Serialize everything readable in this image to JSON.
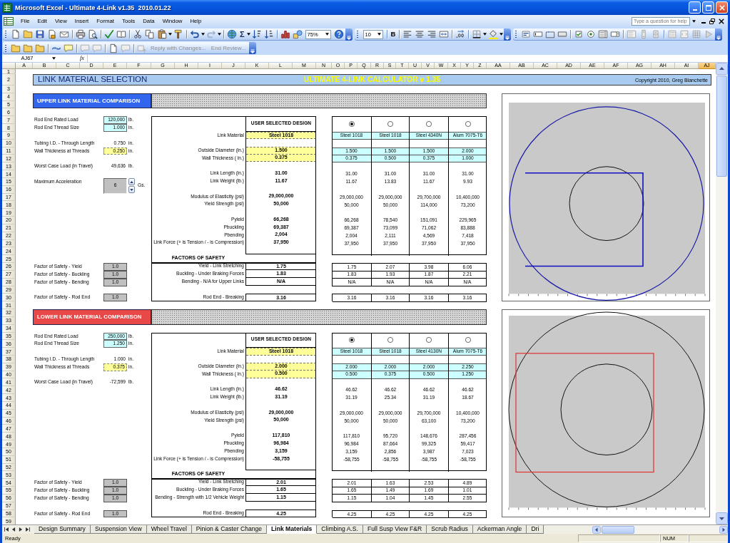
{
  "window": {
    "title": "Microsoft Excel - Ultimate 4-Link v1.35  2010.01.22"
  },
  "menu": [
    "File",
    "Edit",
    "View",
    "Insert",
    "Format",
    "Tools",
    "Data",
    "Window",
    "Help"
  ],
  "help_search": {
    "placeholder": "Type a question for help"
  },
  "standard_toolbar": {
    "autosum": "Σ",
    "zoom": "75%"
  },
  "formatting_toolbar": {
    "font_size": "10",
    "bold": "B"
  },
  "reviewing_toolbar": [
    {
      "label": "Reply with Changes...",
      "disabled": true
    },
    {
      "label": "End Review...",
      "disabled": true
    }
  ],
  "formula_bar": {
    "name_box": "AJ67",
    "function_label": "fx"
  },
  "columns": [
    {
      "label": "A",
      "selected": false
    },
    {
      "label": "B",
      "selected": false
    },
    {
      "label": "C",
      "selected": false
    },
    {
      "label": "D",
      "selected": false
    },
    {
      "label": "E",
      "selected": false
    },
    {
      "label": "F",
      "selected": false
    },
    {
      "label": "G",
      "selected": false
    },
    {
      "label": "H",
      "selected": false
    },
    {
      "label": "I",
      "selected": false
    },
    {
      "label": "J",
      "selected": false
    },
    {
      "label": "K",
      "selected": false
    },
    {
      "label": "L",
      "selected": false
    },
    {
      "label": "M",
      "selected": false
    },
    {
      "label": "N",
      "selected": false
    },
    {
      "label": "O",
      "selected": false
    },
    {
      "label": "P",
      "selected": false
    },
    {
      "label": "Q",
      "selected": false
    },
    {
      "label": "R",
      "selected": false
    },
    {
      "label": "S",
      "selected": false
    },
    {
      "label": "T",
      "selected": false
    },
    {
      "label": "U",
      "selected": false
    },
    {
      "label": "V",
      "selected": false
    },
    {
      "label": "W",
      "selected": false
    },
    {
      "label": "X",
      "selected": false
    },
    {
      "label": "Y",
      "selected": false
    },
    {
      "label": "Z",
      "selected": false
    },
    {
      "label": "AA",
      "selected": false
    },
    {
      "label": "AB",
      "selected": false
    },
    {
      "label": "AC",
      "selected": false
    },
    {
      "label": "AD",
      "selected": false
    },
    {
      "label": "AE",
      "selected": false
    },
    {
      "label": "AF",
      "selected": false
    },
    {
      "label": "AG",
      "selected": false
    },
    {
      "label": "AH",
      "selected": false
    },
    {
      "label": "AI",
      "selected": false
    },
    {
      "label": "AJ",
      "selected": true
    }
  ],
  "rows": [
    "1",
    "2",
    "3",
    "4",
    "5",
    "6",
    "7",
    "8",
    "9",
    "10",
    "11",
    "12",
    "13",
    "14",
    "15",
    "16",
    "17",
    "18",
    "19",
    "20",
    "21",
    "22",
    "23",
    "24",
    "25",
    "26",
    "27",
    "28",
    "29",
    "30",
    "31",
    "32",
    "33",
    "34",
    "35",
    "36",
    "37",
    "38",
    "39",
    "40",
    "41",
    "42",
    "43",
    "44",
    "45",
    "46",
    "47",
    "48",
    "49",
    "50",
    "51",
    "52",
    "53",
    "54",
    "55",
    "56",
    "57",
    "58",
    "59"
  ],
  "banner": {
    "title": "LINK MATERIAL SELECTION",
    "subtitle": "ULTIMATE 4-LINK CALCULATOR v 1.35",
    "copyright": "Copyright 2010, Greg Blanchette"
  },
  "sections": [
    {
      "kind": "upper",
      "title": "UPPER LINK MATERIAL COMPARISON",
      "color": "#3366ee",
      "inputs": [
        {
          "label": "Rod End Rated Load",
          "value": "120,000",
          "unit": "lb.",
          "kind": "entry"
        },
        {
          "label": "Rod End Thread Size",
          "value": "1.000",
          "unit": "in.",
          "kind": "entry"
        },
        {
          "label": "Tubing I.D. - Through Length",
          "value": "0.750",
          "unit": "in.",
          "kind": "computed"
        },
        {
          "label": "Wall Thickness at Threads",
          "value": "0.250",
          "unit": "in.",
          "kind": "highlight"
        },
        {
          "label": "Worst Case Load (in Travel)",
          "value": "49,636",
          "unit": "lb.",
          "kind": "computed"
        },
        {
          "label": "Maximum Acceleration",
          "value": "6",
          "unit": "Gs.",
          "kind": "spinner"
        }
      ],
      "comparison": {
        "header": "USER SELECTED DESIGN",
        "options": [
          {
            "selected": true
          },
          {
            "selected": false
          },
          {
            "selected": false
          },
          {
            "selected": false
          }
        ],
        "properties": [
          {
            "label": "Link Material",
            "kind": "input",
            "design": "Steel 1018",
            "options": [
              "Steel 1018",
              "Steel 1018",
              "Steel 4340N",
              "Alum 7075-T6"
            ]
          },
          {
            "label": "Outside Diameter (in.)",
            "kind": "input",
            "design": "1.500",
            "options": [
              "1.500",
              "1.500",
              "1.500",
              "2.000"
            ]
          },
          {
            "label": "Wall Thickness ( in.)",
            "kind": "input",
            "design": "0.375",
            "options": [
              "0.375",
              "0.500",
              "0.375",
              "1.000"
            ]
          },
          {
            "label": "Link Length (in.)",
            "kind": "result",
            "design": "31.00",
            "options": [
              "31.00",
              "31.00",
              "31.00",
              "31.00"
            ]
          },
          {
            "label": "Link Weight (lb.)",
            "kind": "result",
            "design": "11.67",
            "options": [
              "11.67",
              "13.83",
              "11.67",
              "9.93"
            ]
          },
          {
            "label": "Modulus of Elasticity (psi)",
            "kind": "result",
            "design": "29,000,000",
            "options": [
              "29,000,000",
              "29,000,000",
              "29,700,000",
              "10,400,000"
            ]
          },
          {
            "label": "Yield Strength (psi)",
            "kind": "result",
            "design": "50,000",
            "options": [
              "50,000",
              "50,000",
              "114,000",
              "73,200"
            ]
          },
          {
            "label": "Pyield",
            "kind": "result",
            "design": "66,268",
            "options": [
              "66,268",
              "78,540",
              "151,091",
              "229,965"
            ]
          },
          {
            "label": "Pbuckling",
            "kind": "result",
            "design": "69,387",
            "options": [
              "69,387",
              "73,099",
              "71,062",
              "83,888"
            ]
          },
          {
            "label": "Pbending",
            "kind": "result",
            "design": "2,004",
            "options": [
              "2,004",
              "2,111",
              "4,569",
              "7,418"
            ]
          },
          {
            "label": "Link Force (+ is Tension / - is Compression)",
            "kind": "result",
            "design": "37,950",
            "options": [
              "37,950",
              "37,950",
              "37,950",
              "37,950"
            ]
          }
        ],
        "safety_title": "FACTORS OF SAFETY",
        "safety": [
          {
            "label": "Yield - Link Stretching",
            "design": "1.75",
            "options": [
              "1.75",
              "2.07",
              "3.98",
              "6.06"
            ]
          },
          {
            "label": "Buckling - Under Braking Forces",
            "design": "1.83",
            "options": [
              "1.83",
              "1.93",
              "1.87",
              "2.21"
            ]
          },
          {
            "label": "Bending - N/A for Upper Links",
            "design": "N/A",
            "options": [
              "N/A",
              "N/A",
              "N/A",
              "N/A"
            ]
          },
          {
            "label": "Rod End - Breaking",
            "design": "3.16",
            "options": [
              "3.16",
              "3.16",
              "3.16",
              "3.16"
            ]
          }
        ]
      },
      "factors": [
        {
          "label": "Factor of Safety - Yield",
          "value": "1.0"
        },
        {
          "label": "Factor of Safety - Buckling",
          "value": "1.0"
        },
        {
          "label": "Factor of Safety - Bending",
          "value": "1.0"
        },
        {
          "label": "Factor of Safety - Rod End",
          "value": "1.0"
        }
      ]
    },
    {
      "kind": "lower",
      "title": "LOWER LINK MATERIAL COMPARISON",
      "color": "#e84848",
      "inputs": [
        {
          "label": "Rod End Rated Load",
          "value": "250,000",
          "unit": "lb.",
          "kind": "entry"
        },
        {
          "label": "Rod End Thread Size",
          "value": "1.250",
          "unit": "in.",
          "kind": "entry"
        },
        {
          "label": "Tubing I.D. - Through Length",
          "value": "1.000",
          "unit": "in.",
          "kind": "computed"
        },
        {
          "label": "Wall Thickness at Threads",
          "value": "0.375",
          "unit": "in.",
          "kind": "highlight"
        },
        {
          "label": "Worst Case Load (in Travel)",
          "value": "-72,599",
          "unit": "lb.",
          "kind": "computed"
        }
      ],
      "comparison": {
        "header": "USER SELECTED DESIGN",
        "options": [
          {
            "selected": true
          },
          {
            "selected": false
          },
          {
            "selected": false
          },
          {
            "selected": false
          }
        ],
        "properties": [
          {
            "label": "Link Material",
            "kind": "input",
            "design": "Steel 1018",
            "options": [
              "Steel 1018",
              "Steel 1018",
              "Steel 4130N",
              "Alum 7075-T6"
            ]
          },
          {
            "label": "Outside Diameter (in.)",
            "kind": "input",
            "design": "2.000",
            "options": [
              "2.000",
              "2.000",
              "2.000",
              "2.250"
            ]
          },
          {
            "label": "Wall Thickness ( in.)",
            "kind": "input",
            "design": "0.500",
            "options": [
              "0.500",
              "0.375",
              "0.500",
              "1.250"
            ]
          },
          {
            "label": "Link Length (in.)",
            "kind": "result",
            "design": "46.62",
            "options": [
              "46.62",
              "46.62",
              "46.62",
              "46.62"
            ]
          },
          {
            "label": "Link Weight (lb.)",
            "kind": "result",
            "design": "31.19",
            "options": [
              "31.19",
              "25.34",
              "31.19",
              "18.67"
            ]
          },
          {
            "label": "Modulus of Elasticity (psi)",
            "kind": "result",
            "design": "29,000,000",
            "options": [
              "29,000,000",
              "29,000,000",
              "29,700,000",
              "10,400,000"
            ]
          },
          {
            "label": "Yield Strength (psi)",
            "kind": "result",
            "design": "50,000",
            "options": [
              "50,000",
              "50,000",
              "63,100",
              "73,200"
            ]
          },
          {
            "label": "Pyield",
            "kind": "result",
            "design": "117,810",
            "options": [
              "117,810",
              "95,720",
              "148,676",
              "287,456"
            ]
          },
          {
            "label": "Pbuckling",
            "kind": "result",
            "design": "96,984",
            "options": [
              "96,984",
              "87,664",
              "99,325",
              "59,417"
            ]
          },
          {
            "label": "Pbending",
            "kind": "result",
            "design": "3,159",
            "options": [
              "3,159",
              "2,856",
              "3,987",
              "7,023"
            ]
          },
          {
            "label": "Link Force (+ is Tension / - is Compression)",
            "kind": "result",
            "design": "-58,755",
            "options": [
              "-58,755",
              "-58,755",
              "-58,755",
              "-58,755"
            ]
          }
        ],
        "safety_title": "FACTORS OF SAFETY",
        "safety": [
          {
            "label": "Yield - Link Stretching",
            "design": "2.01",
            "options": [
              "2.01",
              "1.63",
              "2.53",
              "4.89"
            ]
          },
          {
            "label": "Buckling - Under Braking Forces",
            "design": "1.65",
            "options": [
              "1.65",
              "1.49",
              "1.69",
              "1.01"
            ]
          },
          {
            "label": "Bending - Strength with 1/2 Vehicle Weight",
            "design": "1.15",
            "options": [
              "1.15",
              "1.04",
              "1.45",
              "2.55"
            ]
          },
          {
            "label": "Rod End - Breaking",
            "design": "4.25",
            "options": [
              "4.25",
              "4.25",
              "4.25",
              "4.25"
            ]
          }
        ]
      },
      "factors": [
        {
          "label": "Factor of Safety - Yield",
          "value": "1.0"
        },
        {
          "label": "Factor of Safety - Buckling",
          "value": "1.0"
        },
        {
          "label": "Factor of Safety - Bending",
          "value": "1.0"
        },
        {
          "label": "Factor of Safety - Rod End",
          "value": "1.0"
        }
      ]
    }
  ],
  "sheet_tabs": [
    {
      "label": "Design Summary",
      "selected": false
    },
    {
      "label": "Suspension View",
      "selected": false
    },
    {
      "label": "Wheel Travel",
      "selected": false
    },
    {
      "label": "Pinion & Caster Change",
      "selected": false
    },
    {
      "label": "Link Materials",
      "selected": true
    },
    {
      "label": "Climbing A.S.",
      "selected": false
    },
    {
      "label": "Full Susp View F&R",
      "selected": false
    },
    {
      "label": "Scrub Radius",
      "selected": false
    },
    {
      "label": "Ackerman Angle",
      "selected": false
    },
    {
      "label": "Dri",
      "selected": false
    }
  ],
  "status_bar": {
    "mode": "Ready",
    "num_lock": "NUM"
  }
}
